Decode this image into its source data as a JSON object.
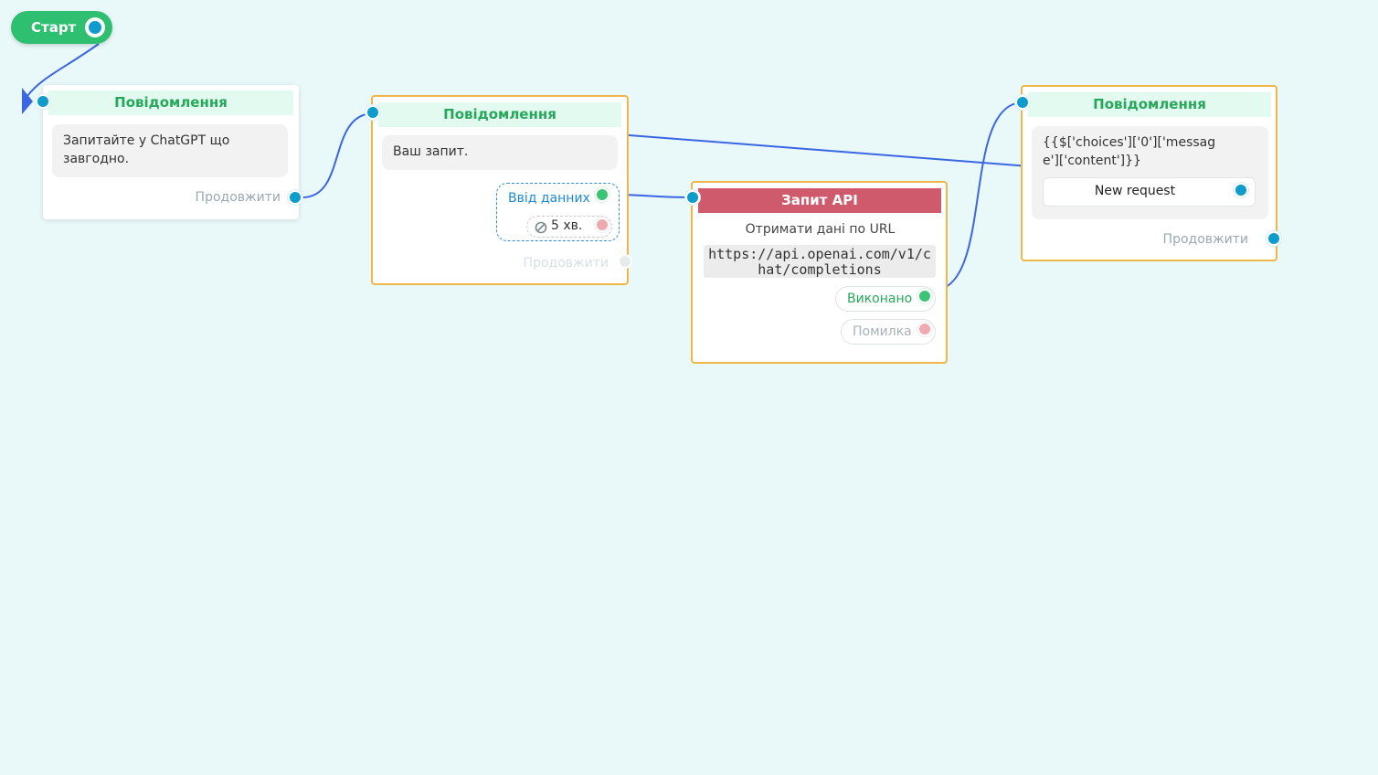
{
  "start": {
    "label": "Старт"
  },
  "nodes": {
    "msg1": {
      "title": "Повідомлення",
      "text": "Запитайте у ChatGPT що завгодно.",
      "continue": "Продовжити"
    },
    "msg2": {
      "title": "Повідомлення",
      "text": "Ваш запит.",
      "input_label": "Ввід данних",
      "timeout_label": "5 хв.",
      "continue": "Продовжити"
    },
    "api": {
      "title": "Запит API",
      "subtitle": "Отримати дані по URL",
      "url": "https://api.openai.com/v1/chat/completions",
      "success": "Виконано",
      "error": "Помилка"
    },
    "msg3": {
      "title": "Повідомлення",
      "text": "{{$['choices']['0']['message']['content']}}",
      "button": "New request",
      "continue": "Продовжити"
    }
  },
  "colors": {
    "wire": "#3b66e3",
    "port": "#0d9ccc",
    "accent_green": "#2fbf71",
    "api_header": "#cf5a6c",
    "selected_border": "#f0b64a",
    "canvas": "#e9f8f9"
  },
  "icons": {
    "timeout": "forbidden-circle-icon",
    "start_port": "ring-port-icon",
    "wire_arrow": "triangle-arrow-icon"
  }
}
